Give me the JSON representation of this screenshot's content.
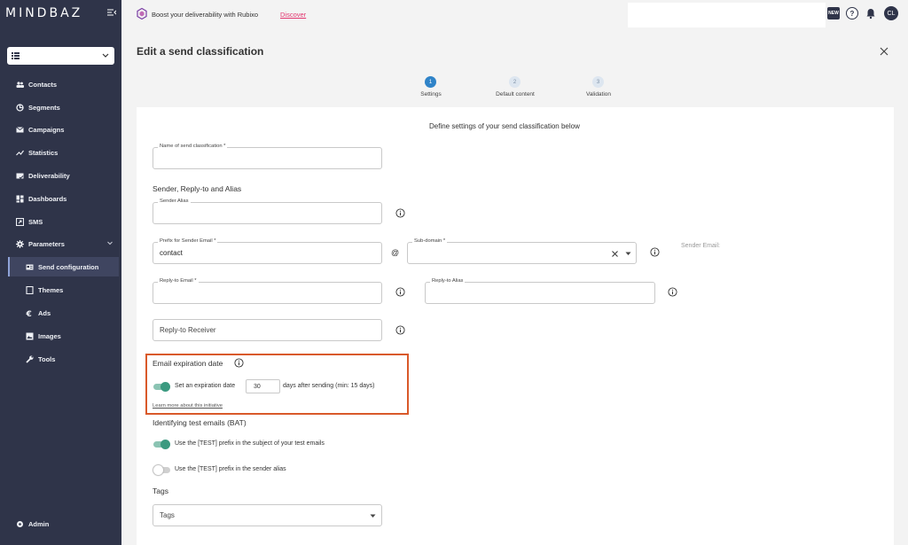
{
  "app": {
    "logo": "MINDBAZ"
  },
  "topbar": {
    "promo_text": "Boost your deliverability with Rubixo",
    "promo_link": "Discover",
    "new_badge": "NEW",
    "avatar_initials": "CL"
  },
  "sidebar": {
    "items": [
      {
        "label": "Contacts",
        "icon": "contacts-icon"
      },
      {
        "label": "Segments",
        "icon": "segments-icon"
      },
      {
        "label": "Campaigns",
        "icon": "mail-icon"
      },
      {
        "label": "Statistics",
        "icon": "chart-icon"
      },
      {
        "label": "Deliverability",
        "icon": "deliverability-icon"
      },
      {
        "label": "Dashboards",
        "icon": "dashboard-icon"
      },
      {
        "label": "SMS",
        "icon": "sms-icon"
      },
      {
        "label": "Parameters",
        "icon": "gear-icon"
      }
    ],
    "sub_items": [
      {
        "label": "Send configuration",
        "icon": "send-config-icon"
      },
      {
        "label": "Themes",
        "icon": "bookmark-icon"
      },
      {
        "label": "Ads",
        "icon": "euro-icon"
      },
      {
        "label": "Images",
        "icon": "image-icon"
      },
      {
        "label": "Tools",
        "icon": "wrench-icon"
      }
    ],
    "admin": "Admin"
  },
  "page": {
    "title": "Edit a send classification",
    "steps": [
      {
        "num": "1",
        "label": "Settings"
      },
      {
        "num": "2",
        "label": "Default content"
      },
      {
        "num": "3",
        "label": "Validation"
      }
    ],
    "card_title": "Define settings of your send classification below"
  },
  "form": {
    "name_label": "Name of send classification *",
    "sender_section": "Sender, Reply-to and Alias",
    "sender_alias_label": "Sender Alias",
    "prefix_label": "Prefix for Sender Email *",
    "prefix_value": "contact",
    "at_sign": "@",
    "subdomain_label": "Sub-domain *",
    "sender_email_label": "Sender Email:",
    "reply_to_email_label": "Reply-to Email *",
    "reply_to_alias_label": "Reply-to Alias",
    "reply_to_receiver": "Reply-to Receiver",
    "expiration_section": "Email expiration date",
    "expiration_toggle_label": "Set an expiration date",
    "expiration_days": "30",
    "expiration_suffix": "days after sending (min: 15 days)",
    "learn_more": "Learn more about this initiative",
    "bat_section": "Identifying test emails (BAT)",
    "bat_subject_label": "Use the [TEST] prefix in the subject of your test emails",
    "bat_alias_label": "Use the [TEST] prefix in the sender alias",
    "tags_section": "Tags",
    "tags_placeholder": "Tags"
  },
  "colors": {
    "sidebar": "#2f3449",
    "accent": "#2f83c8",
    "toggle_on": "#3b9a80",
    "highlight": "#d9592a",
    "link": "#e2346e"
  }
}
